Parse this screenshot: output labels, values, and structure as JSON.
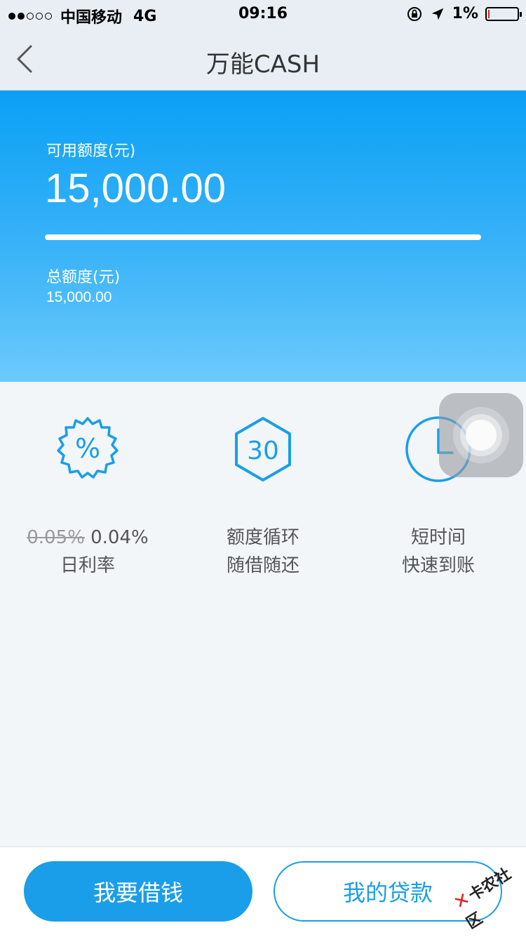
{
  "status_bar": {
    "carrier": "中国移动",
    "network": "4G",
    "time": "09:16",
    "battery": "1%",
    "battery_level": 0.01
  },
  "nav": {
    "title": "万能CASH"
  },
  "credit": {
    "available_label": "可用额度(元)",
    "available_amount": "15,000.00",
    "usage_fraction": 1.0,
    "total_label": "总额度(元)",
    "total_amount": "15,000.00"
  },
  "features": [
    {
      "icon": "percent-badge-icon",
      "old_rate": "0.05%",
      "new_rate": "0.04%",
      "line2": "日利率"
    },
    {
      "icon": "hexagon-30-icon",
      "badge": "30",
      "line1": "额度循环",
      "line2": "随借随还"
    },
    {
      "icon": "clock-icon",
      "line1": "短时间",
      "line2": "快速到账"
    }
  ],
  "buttons": {
    "borrow": "我要借钱",
    "my_loans": "我的贷款"
  },
  "watermark": "卡农社区",
  "colors": {
    "accent": "#1a9ee9",
    "hero_top": "#0aa0f5",
    "hero_bottom": "#6ccafc"
  }
}
